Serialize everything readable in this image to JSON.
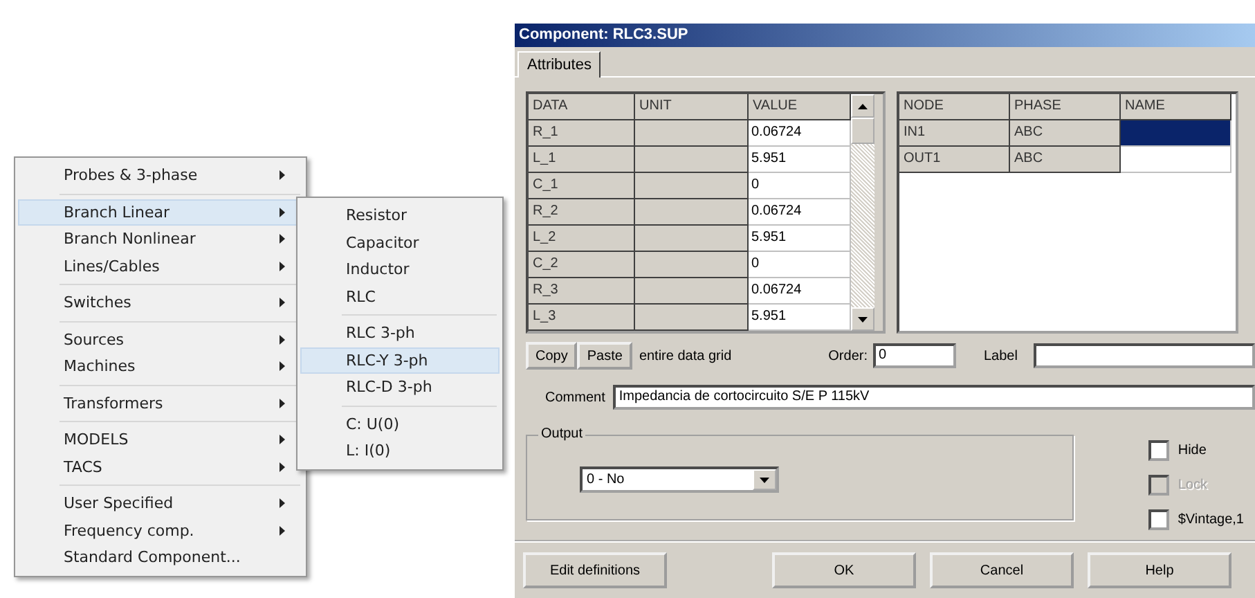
{
  "menu": {
    "groups": [
      [
        {
          "label": "Probes & 3-phase",
          "submenu": true,
          "selected": false
        }
      ],
      [
        {
          "label": "Branch Linear",
          "submenu": true,
          "selected": true
        },
        {
          "label": "Branch Nonlinear",
          "submenu": true,
          "selected": false
        },
        {
          "label": "Lines/Cables",
          "submenu": true,
          "selected": false
        }
      ],
      [
        {
          "label": "Switches",
          "submenu": true,
          "selected": false
        }
      ],
      [
        {
          "label": "Sources",
          "submenu": true,
          "selected": false
        },
        {
          "label": "Machines",
          "submenu": true,
          "selected": false
        }
      ],
      [
        {
          "label": "Transformers",
          "submenu": true,
          "selected": false
        }
      ],
      [
        {
          "label": "MODELS",
          "submenu": true,
          "selected": false
        },
        {
          "label": "TACS",
          "submenu": true,
          "selected": false
        }
      ],
      [
        {
          "label": "User Specified",
          "submenu": true,
          "selected": false
        },
        {
          "label": "Frequency comp.",
          "submenu": true,
          "selected": false
        },
        {
          "label": "Standard Component...",
          "submenu": false,
          "selected": false
        }
      ]
    ]
  },
  "submenu": {
    "groups": [
      [
        {
          "label": "Resistor",
          "selected": false
        },
        {
          "label": "Capacitor",
          "selected": false
        },
        {
          "label": "Inductor",
          "selected": false
        },
        {
          "label": "RLC",
          "selected": false
        }
      ],
      [
        {
          "label": "RLC 3-ph",
          "selected": false
        },
        {
          "label": "RLC-Y 3-ph",
          "selected": true
        },
        {
          "label": "RLC-D 3-ph",
          "selected": false
        }
      ],
      [
        {
          "label": "C: U(0)",
          "selected": false
        },
        {
          "label": "L: I(0)",
          "selected": false
        }
      ]
    ]
  },
  "dialog": {
    "title": "Component: RLC3.SUP",
    "tabs": [
      {
        "label": "Attributes",
        "selected": true
      }
    ],
    "data_grid": {
      "columns": [
        "DATA",
        "UNIT",
        "VALUE"
      ],
      "rows": [
        {
          "data": "R_1",
          "value": "0.06724"
        },
        {
          "data": "L_1",
          "value": "5.951"
        },
        {
          "data": "C_1",
          "value": "0"
        },
        {
          "data": "R_2",
          "value": "0.06724"
        },
        {
          "data": "L_2",
          "value": "5.951"
        },
        {
          "data": "C_2",
          "value": "0"
        },
        {
          "data": "R_3",
          "value": "0.06724"
        },
        {
          "data": "L_3",
          "value": "5.951"
        }
      ]
    },
    "node_grid": {
      "columns": [
        "NODE",
        "PHASE",
        "NAME"
      ],
      "rows": [
        {
          "node": "IN1",
          "phase": "ABC",
          "name_selected": true
        },
        {
          "node": "OUT1",
          "phase": "ABC",
          "name_selected": false
        }
      ]
    },
    "grid_buttons": [
      "Copy",
      "Paste"
    ],
    "grid_note": "entire data grid",
    "order": {
      "label": "Order:",
      "value": "0"
    },
    "label_field": {
      "label": "Label"
    },
    "comment": {
      "label": "Comment",
      "value": "Impedancia de cortocircuito S/E P 115kV"
    },
    "output": {
      "title": "Output",
      "value": "0 - No"
    },
    "checkboxes": [
      {
        "label": "Hide",
        "checked": false,
        "disabled": false
      },
      {
        "label": "Lock",
        "checked": false,
        "disabled": true
      },
      {
        "label": "$Vintage,1",
        "checked": false,
        "disabled": false
      }
    ],
    "footer_buttons": [
      "Edit definitions",
      "OK",
      "Cancel",
      "Help"
    ]
  }
}
